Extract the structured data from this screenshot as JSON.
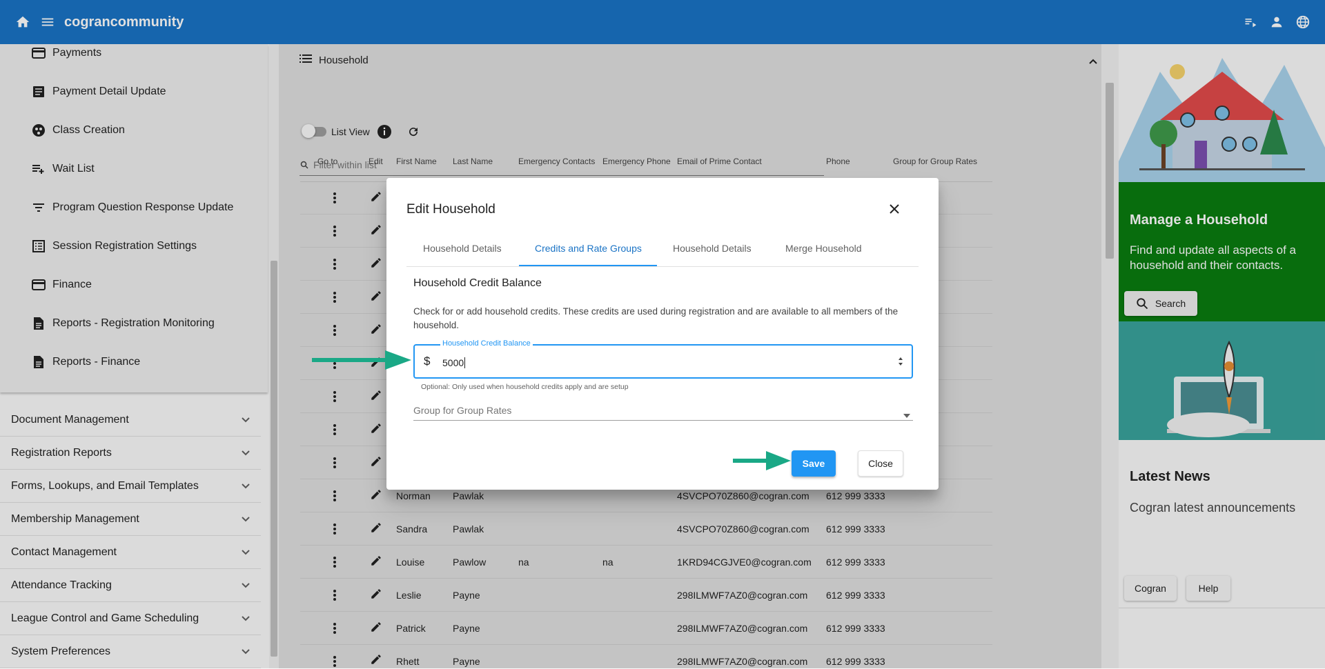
{
  "header": {
    "app_title": "cograncommunity",
    "icons": [
      "home-icon",
      "menu-icon",
      "playlist-icon",
      "account-icon",
      "language-icon"
    ]
  },
  "sidebar": {
    "sub_items": [
      {
        "label": "Payments",
        "icon": "credit-card-icon"
      },
      {
        "label": "Payment Detail Update",
        "icon": "document-icon"
      },
      {
        "label": "Class Creation",
        "icon": "group-circle-icon"
      },
      {
        "label": "Wait List",
        "icon": "playlist-add-icon"
      },
      {
        "label": "Program Question Response Update",
        "icon": "filter-icon"
      },
      {
        "label": "Session Registration Settings",
        "icon": "list-box-icon"
      },
      {
        "label": "Finance",
        "icon": "credit-card-icon"
      },
      {
        "label": "Reports - Registration Monitoring",
        "icon": "report-icon"
      },
      {
        "label": "Reports - Finance",
        "icon": "report-icon"
      }
    ],
    "sections": [
      {
        "label": "Document Management"
      },
      {
        "label": "Registration Reports"
      },
      {
        "label": "Forms, Lookups, and Email Templates"
      },
      {
        "label": "Membership Management"
      },
      {
        "label": "Contact Management"
      },
      {
        "label": "Attendance Tracking"
      },
      {
        "label": "League Control and Game Scheduling"
      },
      {
        "label": "System Preferences"
      }
    ]
  },
  "main": {
    "panel_title": "Household",
    "list_view_label": "List View",
    "filter_placeholder": "Filter within list",
    "columns": [
      "Go to",
      "Edit",
      "First Name",
      "Last Name",
      "Emergency Contacts",
      "Emergency Phone",
      "Email of Prime Contact",
      "Phone",
      "Group for Group Rates"
    ],
    "rows": [
      {
        "first": "Norman",
        "last": "Pawlak",
        "ec": "",
        "ep": "",
        "email": "4SVCPO70Z860@cogran.com",
        "phone": "612 999 3333"
      },
      {
        "first": "Sandra",
        "last": "Pawlak",
        "ec": "",
        "ep": "",
        "email": "4SVCPO70Z860@cogran.com",
        "phone": "612 999 3333"
      },
      {
        "first": "Louise",
        "last": "Pawlow",
        "ec": "na",
        "ep": "na",
        "email": "1KRD94CGJVE0@cogran.com",
        "phone": "612 999 3333"
      },
      {
        "first": "Leslie",
        "last": "Payne",
        "ec": "",
        "ep": "",
        "email": "298ILMWF7AZ0@cogran.com",
        "phone": "612 999 3333"
      },
      {
        "first": "Patrick",
        "last": "Payne",
        "ec": "",
        "ep": "",
        "email": "298ILMWF7AZ0@cogran.com",
        "phone": "612 999 3333"
      },
      {
        "first": "Rhett",
        "last": "Payne",
        "ec": "",
        "ep": "",
        "email": "298ILMWF7AZ0@cogran.com",
        "phone": "612 999 3333"
      }
    ]
  },
  "right": {
    "manage_title": "Manage a Household",
    "manage_text": "Find and update all aspects of a household and their contacts.",
    "search_label": "Search",
    "news_title": "Latest News",
    "news_text": "Cogran latest announcements",
    "cogran_label": "Cogran",
    "help_label": "Help"
  },
  "dialog": {
    "title": "Edit Household",
    "tabs": [
      "Household Details",
      "Credits and Rate Groups",
      "Household Details",
      "Merge Household"
    ],
    "active_tab": 1,
    "section_title": "Household Credit Balance",
    "description": "Check for or add household credits. These credits are used during registration and are available to all members of the household.",
    "credit_label": "Household Credit Balance",
    "currency_symbol": "$",
    "credit_value": "5000",
    "credit_hint": "Optional: Only used when household credits apply and are setup",
    "group_placeholder": "Group for Group Rates",
    "save_label": "Save",
    "close_label": "Close"
  },
  "colors": {
    "header": "#1a73c5",
    "accent": "#2196f3",
    "manage_bg": "#0a7d0f",
    "arrow": "#1aa886"
  }
}
